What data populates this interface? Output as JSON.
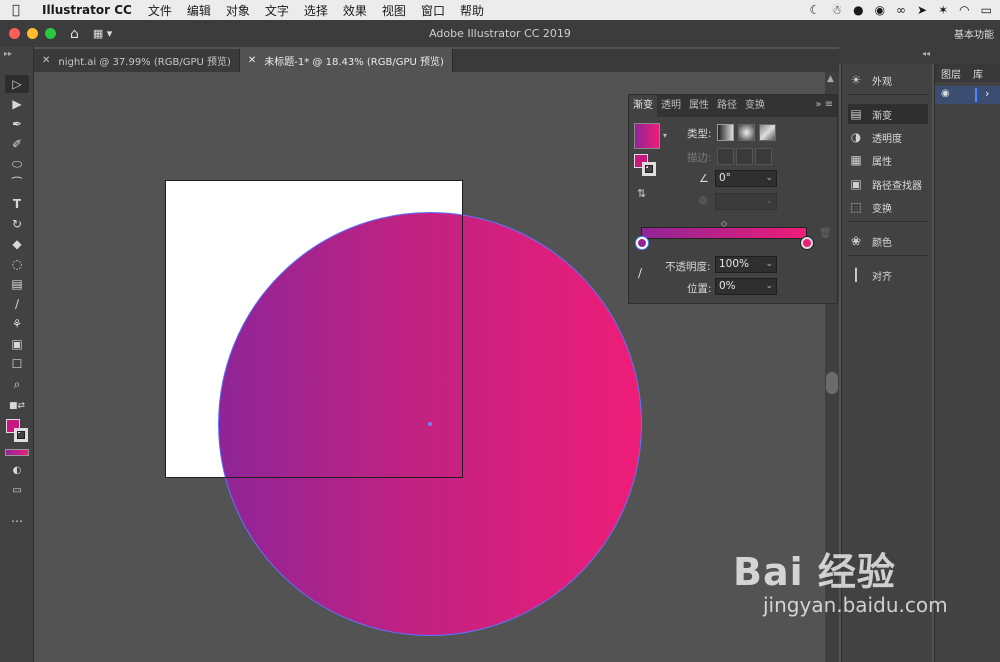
{
  "menubar": {
    "apple": "",
    "app_name": "Illustrator CC",
    "items": [
      "文件",
      "编辑",
      "对象",
      "文字",
      "选择",
      "效果",
      "视图",
      "窗口",
      "帮助"
    ]
  },
  "titlebar": {
    "title": "Adobe Illustrator CC 2019",
    "workspace": "基本功能"
  },
  "tabs": [
    {
      "label": "night.ai @ 37.99% (RGB/GPU 预览)",
      "active": false
    },
    {
      "label": "未标题-1* @ 18.43% (RGB/GPU 预览)",
      "active": true
    }
  ],
  "gradient_panel": {
    "tabs": [
      "渐变",
      "透明",
      "属性",
      "路径",
      "变换"
    ],
    "type_label": "类型:",
    "stroke_label": "描边:",
    "angle": "0°",
    "opacity_label": "不透明度:",
    "opacity": "100%",
    "location_label": "位置:",
    "location": "0%",
    "colors": {
      "start": "#8f2597",
      "end": "#ee1d78"
    }
  },
  "dock": {
    "items": [
      {
        "label": "外观",
        "icon": "sun-icon"
      },
      {
        "label": "渐变",
        "icon": "gradient-icon"
      },
      {
        "label": "透明度",
        "icon": "transparency-icon"
      },
      {
        "label": "属性",
        "icon": "properties-icon"
      },
      {
        "label": "路径查找器",
        "icon": "pathfinder-icon"
      },
      {
        "label": "变换",
        "icon": "transform-icon"
      },
      {
        "label": "颜色",
        "icon": "palette-icon"
      },
      {
        "label": "对齐",
        "icon": "align-icon"
      }
    ]
  },
  "layers": {
    "tabs": [
      "图层",
      "库"
    ]
  },
  "watermark": {
    "brand": "Bai 经验",
    "url": "jingyan.baidu.com"
  },
  "colors": {
    "fill": "#c8187e",
    "accent": "#4a8cff"
  }
}
